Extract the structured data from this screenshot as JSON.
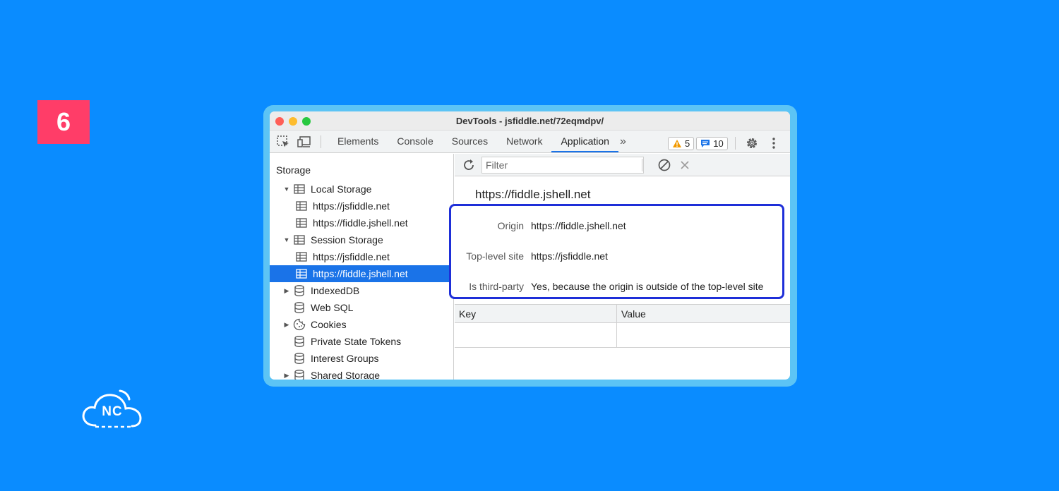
{
  "step_number": "6",
  "logo_text": "NC",
  "window": {
    "title": "DevTools - jsfiddle.net/72eqmdpv/"
  },
  "toolbar": {
    "tabs": [
      "Elements",
      "Console",
      "Sources",
      "Network",
      "Application"
    ],
    "active_tab": "Application",
    "more_tabs_label": "»",
    "warnings_count": "5",
    "messages_count": "10"
  },
  "sidebar": {
    "header": "Storage",
    "items": [
      {
        "label": "Local Storage",
        "arrow": "▼",
        "icon": "table-icon"
      },
      {
        "label": "https://jsfiddle.net",
        "icon": "table-icon"
      },
      {
        "label": "https://fiddle.jshell.net",
        "icon": "table-icon"
      },
      {
        "label": "Session Storage",
        "arrow": "▼",
        "icon": "table-icon"
      },
      {
        "label": "https://jsfiddle.net",
        "icon": "table-icon"
      },
      {
        "label": "https://fiddle.jshell.net",
        "icon": "table-icon",
        "selected": true
      },
      {
        "label": "IndexedDB",
        "arrow": "▶",
        "icon": "database-icon"
      },
      {
        "label": "Web SQL",
        "icon": "database-icon"
      },
      {
        "label": "Cookies",
        "arrow": "▶",
        "icon": "cookie-icon"
      },
      {
        "label": "Private State Tokens",
        "icon": "database-icon"
      },
      {
        "label": "Interest Groups",
        "icon": "database-icon"
      },
      {
        "label": "Shared Storage",
        "arrow": "▶",
        "icon": "database-icon"
      }
    ]
  },
  "filter": {
    "placeholder": "Filter"
  },
  "main": {
    "origin_heading": "https://fiddle.jshell.net",
    "info": [
      {
        "key": "Origin",
        "value": "https://fiddle.jshell.net"
      },
      {
        "key": "Top-level site",
        "value": "https://jsfiddle.net"
      },
      {
        "key": "Is third-party",
        "value": "Yes, because the origin is outside of the top-level site"
      }
    ],
    "table": {
      "columns": [
        "Key",
        "Value"
      ]
    }
  },
  "colors": {
    "background": "#0a8cff",
    "badge": "#ff3d68",
    "frame": "#5cc4f5",
    "highlight_border": "#1e2fd8",
    "selection": "#1a73e8"
  }
}
